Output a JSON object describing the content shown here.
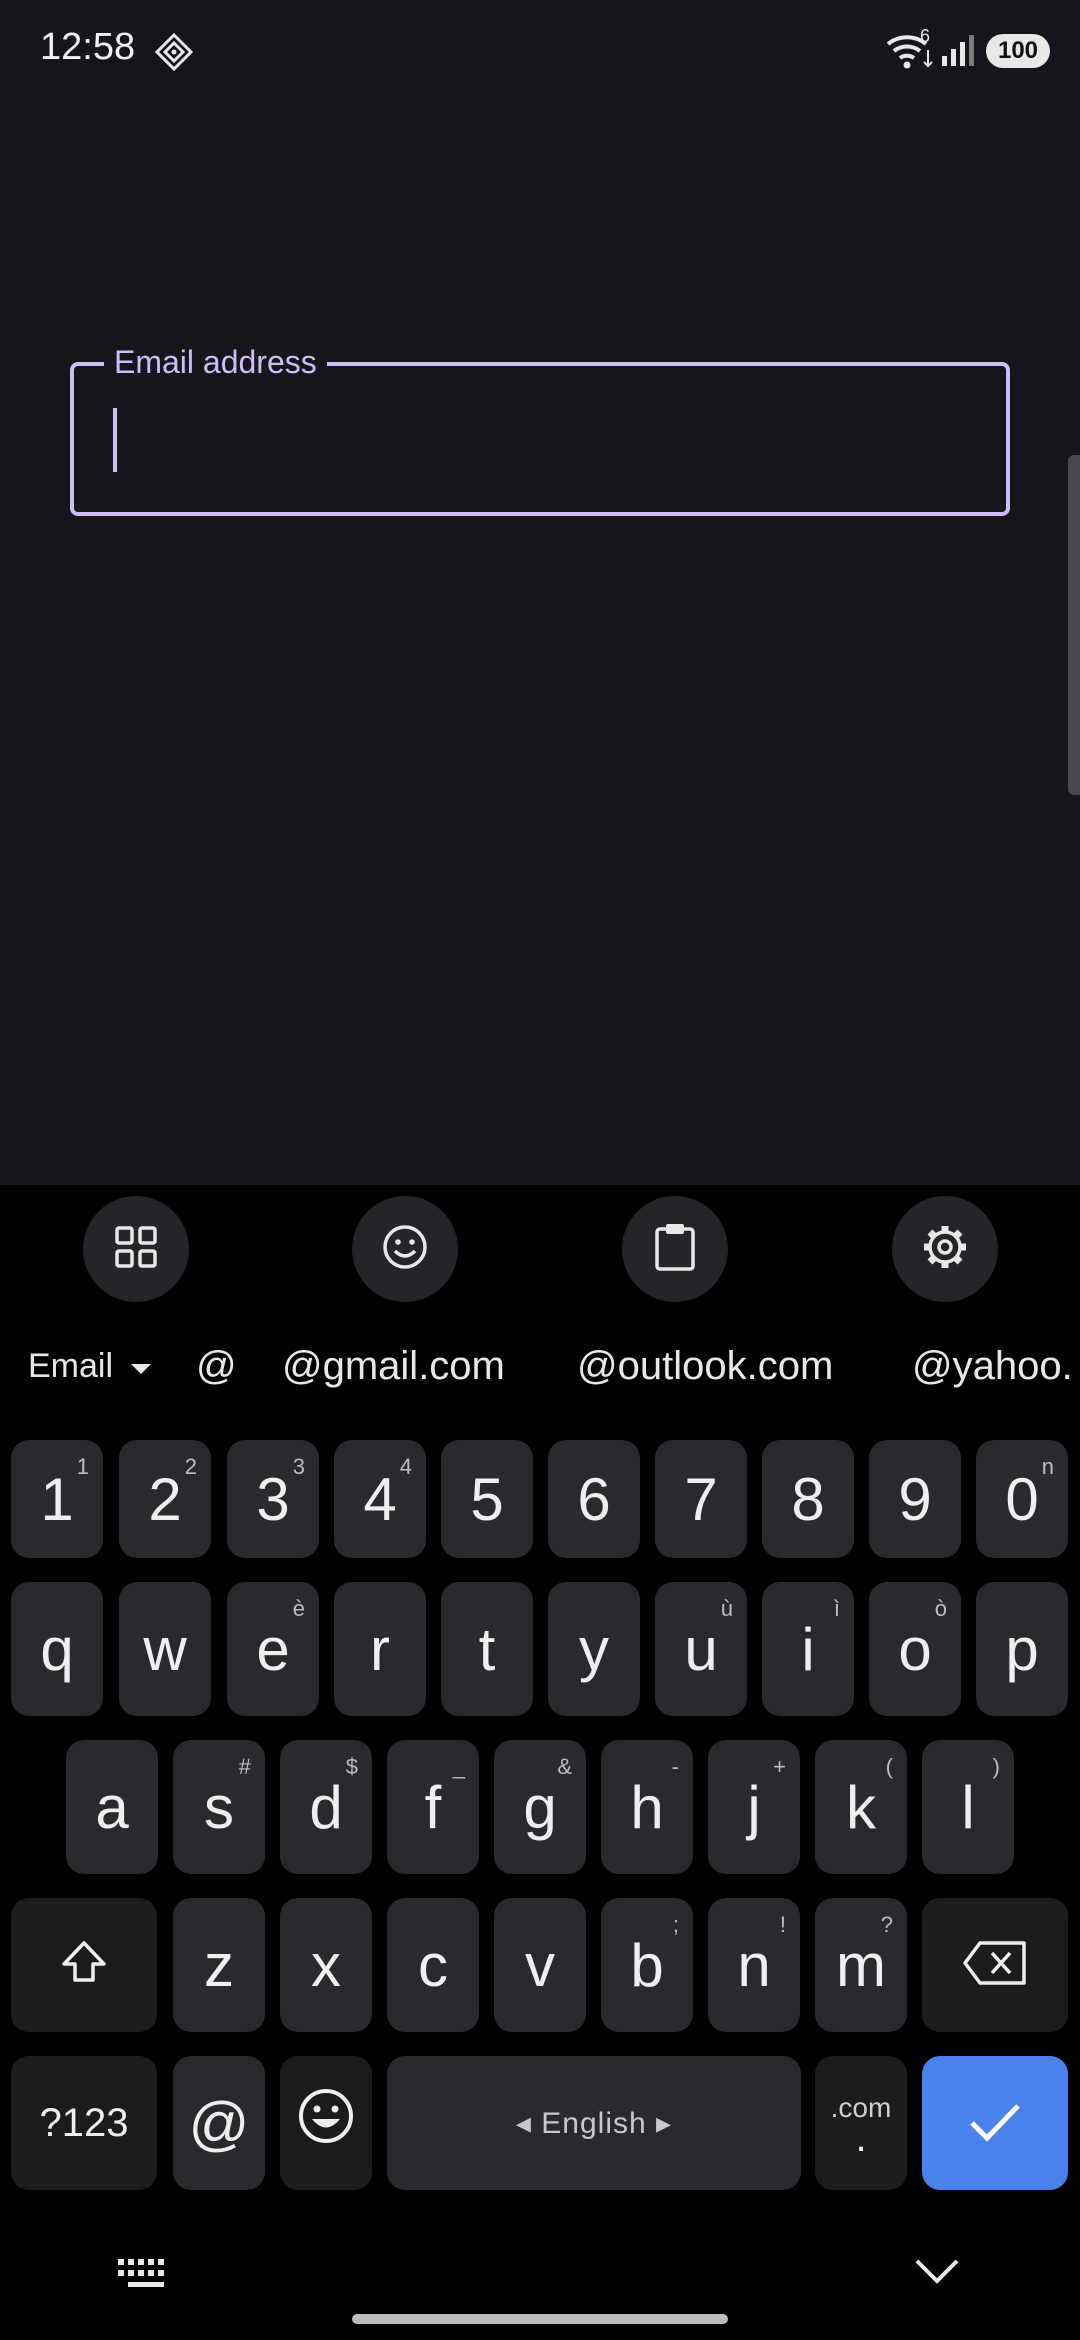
{
  "status_bar": {
    "time": "12:58",
    "wifi_badge": "6",
    "battery": "100"
  },
  "form": {
    "email_label": "Email address",
    "email_value": "",
    "email_placeholder": ""
  },
  "keyboard": {
    "suggestions": {
      "mode": "Email",
      "items": [
        "@",
        "@gmail.com",
        "@outlook.com",
        "@yahoo."
      ]
    },
    "number_row": [
      {
        "key": "1",
        "hint": "1"
      },
      {
        "key": "2",
        "hint": "2"
      },
      {
        "key": "3",
        "hint": "3"
      },
      {
        "key": "4",
        "hint": "4"
      },
      {
        "key": "5",
        "hint": ""
      },
      {
        "key": "6",
        "hint": ""
      },
      {
        "key": "7",
        "hint": ""
      },
      {
        "key": "8",
        "hint": ""
      },
      {
        "key": "9",
        "hint": ""
      },
      {
        "key": "0",
        "hint": "n"
      }
    ],
    "row1": [
      {
        "key": "q",
        "hint": ""
      },
      {
        "key": "w",
        "hint": ""
      },
      {
        "key": "e",
        "hint": "è"
      },
      {
        "key": "r",
        "hint": ""
      },
      {
        "key": "t",
        "hint": ""
      },
      {
        "key": "y",
        "hint": ""
      },
      {
        "key": "u",
        "hint": "ù"
      },
      {
        "key": "i",
        "hint": "ì"
      },
      {
        "key": "o",
        "hint": "ò"
      },
      {
        "key": "p",
        "hint": ""
      }
    ],
    "row2": [
      {
        "key": "a",
        "hint": ""
      },
      {
        "key": "s",
        "hint": "#"
      },
      {
        "key": "d",
        "hint": "$"
      },
      {
        "key": "f",
        "hint": "_"
      },
      {
        "key": "g",
        "hint": "&"
      },
      {
        "key": "h",
        "hint": "-"
      },
      {
        "key": "j",
        "hint": "+"
      },
      {
        "key": "k",
        "hint": "("
      },
      {
        "key": "l",
        "hint": ")"
      }
    ],
    "row3": [
      {
        "key": "z",
        "hint": ""
      },
      {
        "key": "x",
        "hint": ""
      },
      {
        "key": "c",
        "hint": ""
      },
      {
        "key": "v",
        "hint": ""
      },
      {
        "key": "b",
        "hint": ";"
      },
      {
        "key": "n",
        "hint": "!"
      },
      {
        "key": "m",
        "hint": "?"
      }
    ],
    "bottom_row": {
      "symbols": "?123",
      "at": "@",
      "space_label": "◂ English ▸",
      "dotcom_top": ".com",
      "dotcom_bottom": "."
    },
    "icons": [
      "grid-icon",
      "emoji-icon",
      "clipboard-icon",
      "settings-icon",
      "shift-icon",
      "backspace-icon",
      "checkmark-icon",
      "keyboard-icon",
      "chevron-down-icon"
    ],
    "colors": {
      "accent": "#cdbdf6",
      "enter_key": "#4a82ec",
      "key": "#2a2a2e",
      "app_background": "#16151b"
    }
  }
}
